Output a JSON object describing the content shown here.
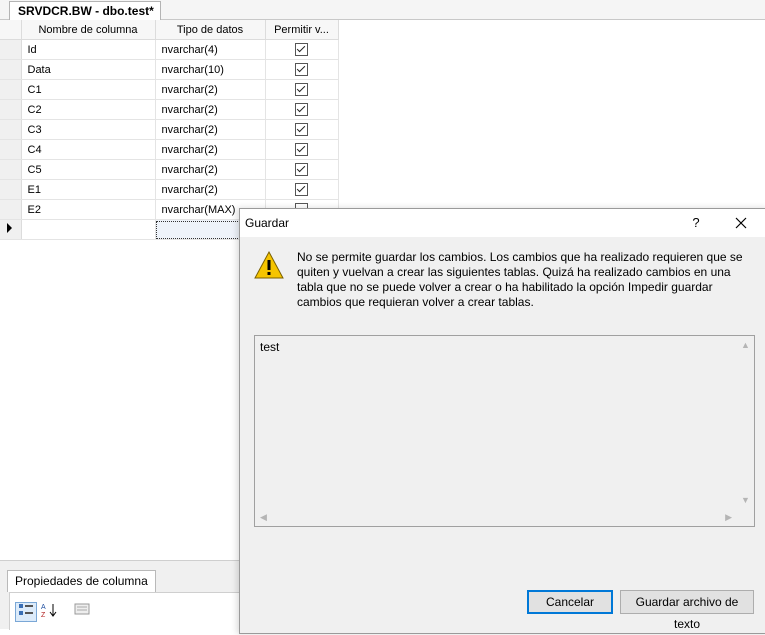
{
  "document_tab": {
    "title": "SRVDCR.BW - dbo.test*"
  },
  "grid": {
    "columns": [
      "Nombre de columna",
      "Tipo de datos",
      "Permitir v..."
    ],
    "rows": [
      {
        "name": "Id",
        "type": "nvarchar(4)",
        "allow_null": true
      },
      {
        "name": "Data",
        "type": "nvarchar(10)",
        "allow_null": true
      },
      {
        "name": "C1",
        "type": "nvarchar(2)",
        "allow_null": true
      },
      {
        "name": "C2",
        "type": "nvarchar(2)",
        "allow_null": true
      },
      {
        "name": "C3",
        "type": "nvarchar(2)",
        "allow_null": true
      },
      {
        "name": "C4",
        "type": "nvarchar(2)",
        "allow_null": true
      },
      {
        "name": "C5",
        "type": "nvarchar(2)",
        "allow_null": true
      },
      {
        "name": "E1",
        "type": "nvarchar(2)",
        "allow_null": true
      },
      {
        "name": "E2",
        "type": "nvarchar(MAX)",
        "allow_null": false
      }
    ]
  },
  "properties_panel": {
    "tab_label": "Propiedades de columna",
    "toolbar_icons": [
      "categorized-icon",
      "alphabetical-sort-icon",
      "property-pages-icon"
    ]
  },
  "dialog": {
    "title": "Guardar",
    "help_label": "?",
    "message": "No se permite guardar los cambios. Los cambios que ha realizado requieren que se quiten y vuelvan a crear las siguientes tablas. Quizá ha realizado cambios en una tabla que no se puede volver a crear o ha habilitado la opción Impedir guardar cambios que requieran volver a crear tablas.",
    "details": "test",
    "buttons": {
      "cancel": "Cancelar",
      "save_text": "Guardar archivo de texto"
    }
  },
  "colors": {
    "accent": "#0078d7",
    "warning_yellow": "#f5c400",
    "dialog_bg": "#f0f0f0"
  }
}
